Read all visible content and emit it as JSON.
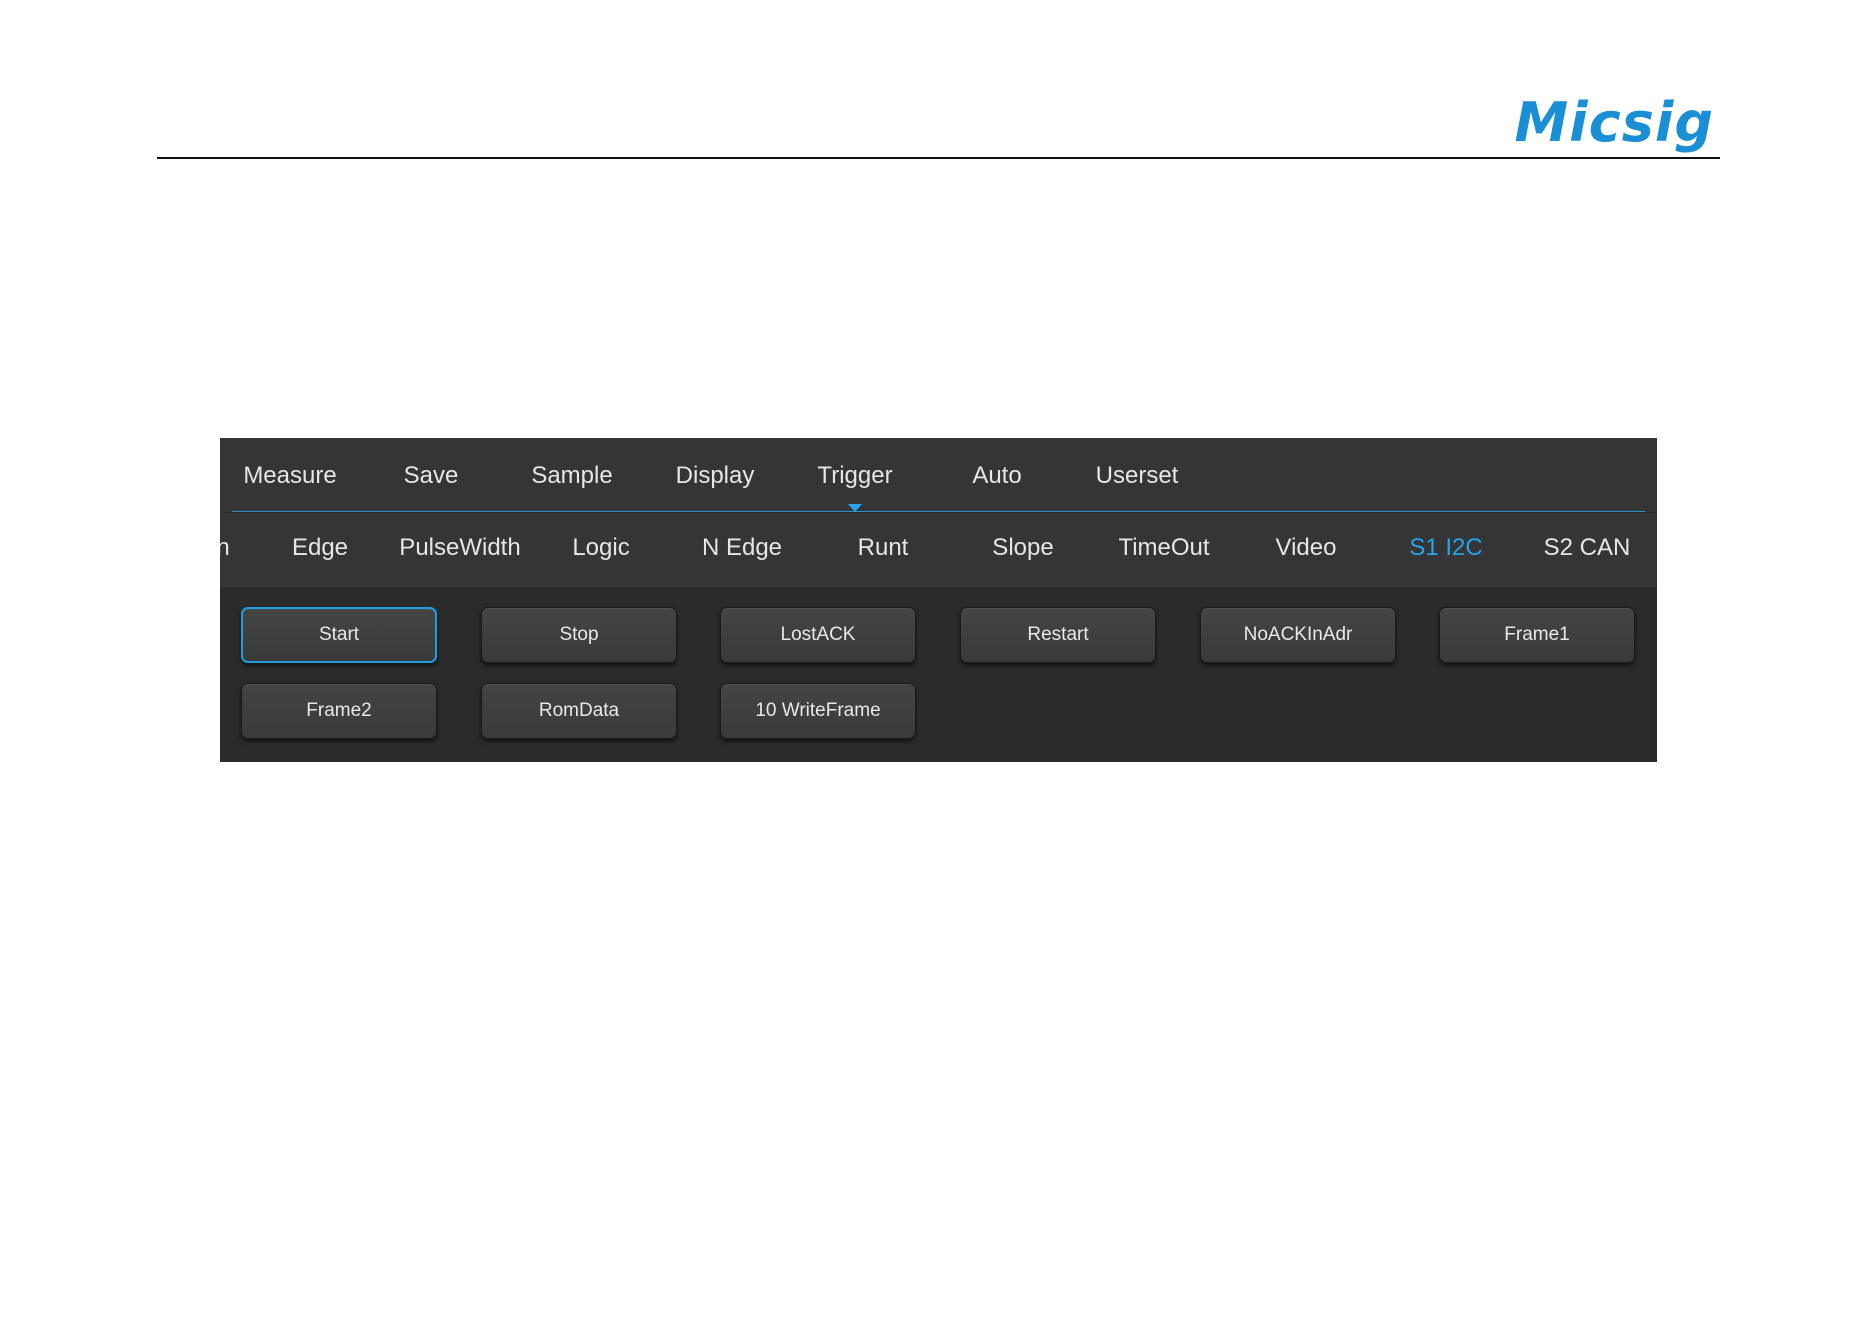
{
  "brand": {
    "logo_text": "Micsig",
    "accent_color": "#1a8fd6"
  },
  "menu": {
    "items": [
      "Measure",
      "Save",
      "Sample",
      "Display",
      "Trigger",
      "Auto",
      "Userset"
    ],
    "active": "Trigger"
  },
  "trigger_types": {
    "clipped_item": "n",
    "items": [
      "Edge",
      "PulseWidth",
      "Logic",
      "N Edge",
      "Runt",
      "Slope",
      "TimeOut",
      "Video",
      "S1 I2C",
      "S2 CAN"
    ],
    "active": "S1 I2C",
    "active_color": "#22a5ea"
  },
  "i2c_conditions": {
    "buttons": [
      "Start",
      "Stop",
      "LostACK",
      "Restart",
      "NoACKInAdr",
      "Frame1",
      "Frame2",
      "RomData",
      "10 WriteFrame"
    ],
    "selected": "Start",
    "selected_border_color": "#1e9de0"
  }
}
